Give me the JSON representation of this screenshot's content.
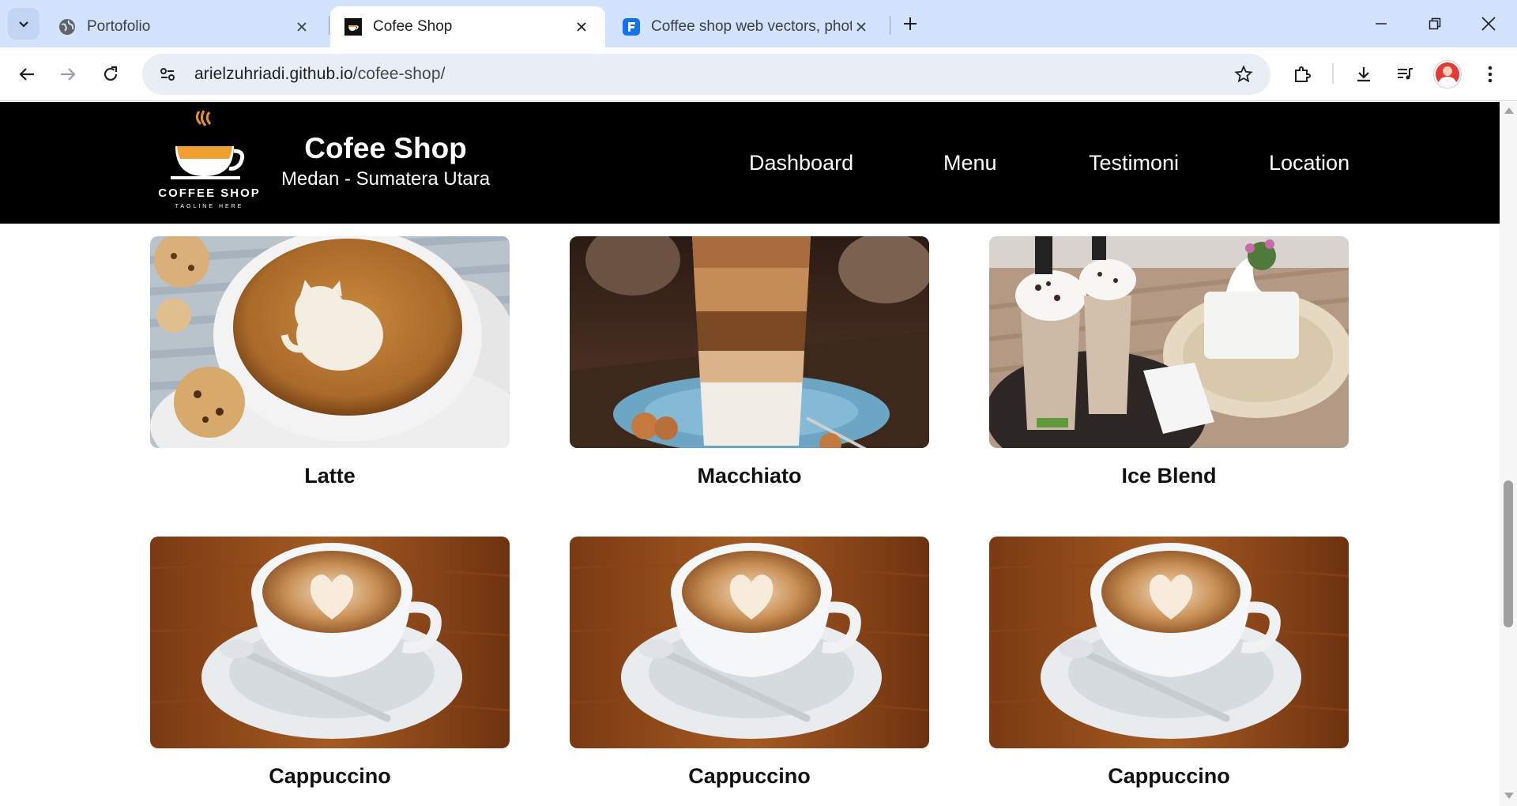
{
  "browser": {
    "tabs": [
      {
        "title": "Portofolio",
        "active": false
      },
      {
        "title": "Cofee Shop",
        "active": true
      },
      {
        "title": "Coffee shop web vectors, photo",
        "active": false
      }
    ],
    "url_host": "arielzuhriadi.github.io",
    "url_path": "/cofee-shop/"
  },
  "site": {
    "logo_text": "COFFEE SHOP",
    "logo_tagline": "TAGLINE HERE",
    "title": "Cofee Shop",
    "subtitle": "Medan - Sumatera Utara",
    "nav": [
      "Dashboard",
      "Menu",
      "Testimoni",
      "Location"
    ]
  },
  "menu_items": [
    {
      "name": "Latte",
      "image": "latte-art-cat"
    },
    {
      "name": "Macchiato",
      "image": "layered-macchiato-glass"
    },
    {
      "name": "Ice Blend",
      "image": "iced-blended-drinks"
    },
    {
      "name": "Cappuccino",
      "image": "cappuccino-heart-art"
    },
    {
      "name": "Cappuccino",
      "image": "cappuccino-heart-art"
    },
    {
      "name": "Cappuccino",
      "image": "cappuccino-heart-art"
    }
  ],
  "colors": {
    "header_bg": "#000000",
    "tabstrip_bg": "#d3e3fd",
    "omnibox_bg": "#e9eef6"
  }
}
